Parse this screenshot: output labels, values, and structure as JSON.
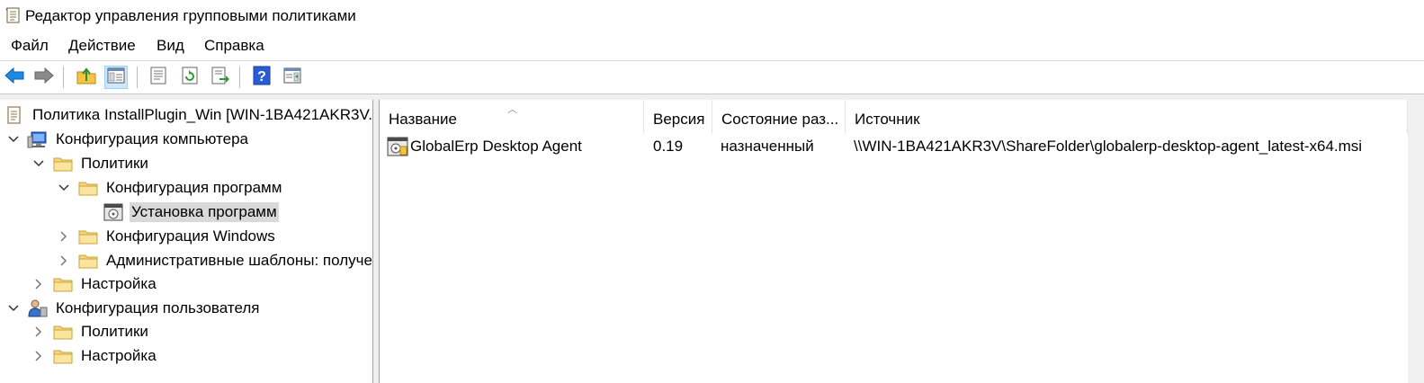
{
  "window": {
    "title": "Редактор управления групповыми политиками",
    "icon": "policy-document-icon"
  },
  "menu": {
    "items": [
      "Файл",
      "Действие",
      "Вид",
      "Справка"
    ]
  },
  "toolbar": {
    "buttons": [
      {
        "name": "back-button",
        "icon": "arrow-left-icon",
        "color": "#1e88e5"
      },
      {
        "name": "forward-button",
        "icon": "arrow-right-icon",
        "color": "#7a7a7a"
      },
      {
        "name": "up-folder-button",
        "icon": "folder-up-icon"
      },
      {
        "name": "show-hide-tree-button",
        "icon": "console-tree-icon",
        "active": true
      },
      {
        "name": "properties-button",
        "icon": "properties-icon"
      },
      {
        "name": "refresh-button",
        "icon": "refresh-icon"
      },
      {
        "name": "export-list-button",
        "icon": "export-list-icon"
      },
      {
        "name": "help-button",
        "icon": "help-icon"
      },
      {
        "name": "show-hide-action-pane-button",
        "icon": "action-pane-icon"
      }
    ]
  },
  "tree": {
    "root": "Политика InstallPlugin_Win [WIN-1BA421AKR3V.",
    "computer_config": "Конфигурация компьютера",
    "policies": "Политики",
    "software_config": "Конфигурация программ",
    "software_install": "Установка программ",
    "windows_config": "Конфигурация Windows",
    "admin_templates": "Административные шаблоны: получе",
    "settings": "Настройка",
    "user_config": "Конфигурация пользователя",
    "user_policies": "Политики",
    "user_settings": "Настройка"
  },
  "list": {
    "columns": [
      "Название",
      "Версия",
      "Состояние раз...",
      "Источник"
    ],
    "rows": [
      {
        "name": "GlobalErp Desktop Agent",
        "version": "0.19",
        "state": "назначенный",
        "source": "\\\\WIN-1BA421AKR3V\\ShareFolder\\globalerp-desktop-agent_latest-x64.msi"
      }
    ]
  },
  "colors": {
    "selection": "#d9d9d9",
    "toolbar_active": "#cce8ff",
    "folder": "#f5d67a"
  }
}
